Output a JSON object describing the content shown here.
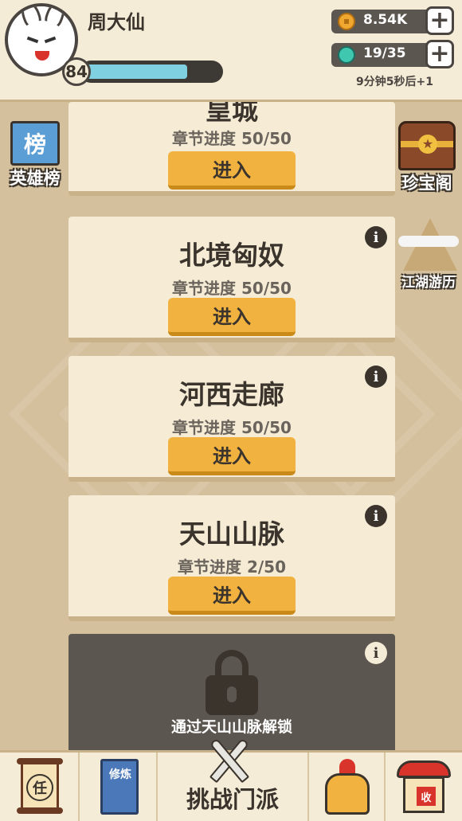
{
  "player": {
    "name": "周大仙",
    "level": "84",
    "exp_fraction": 0.75
  },
  "resources": {
    "coins": "8.54K",
    "stamina": "19/35",
    "regen_timer": "9分钟5秒后+1"
  },
  "side_buttons": {
    "hero_rank": "英雄榜",
    "hero_rank_flag": "榜",
    "treasure": "珍宝阁",
    "jianghu": "江湖游历"
  },
  "stages": [
    {
      "title": "皇城",
      "progress": "章节进度 50/50",
      "enter": "进入"
    },
    {
      "title": "北境匈奴",
      "progress": "章节进度 50/50",
      "enter": "进入"
    },
    {
      "title": "河西走廊",
      "progress": "章节进度 50/50",
      "enter": "进入"
    },
    {
      "title": "天山山脉",
      "progress": "章节进度 2/50",
      "enter": "进入"
    }
  ],
  "locked_stage": {
    "unlock_text": "通过天山山脉解锁"
  },
  "info_symbol": "i",
  "bottom_nav": {
    "task_glyph": "任",
    "train_glyph": "修炼",
    "challenge": "挑战门派",
    "collect_glyph": "收"
  },
  "colors": {
    "background": "#d4c09c",
    "card": "#f6ecd6",
    "enter_button": "#f2b23f",
    "exp_fill": "#7fd0e0",
    "locked_card": "#5b5650"
  }
}
